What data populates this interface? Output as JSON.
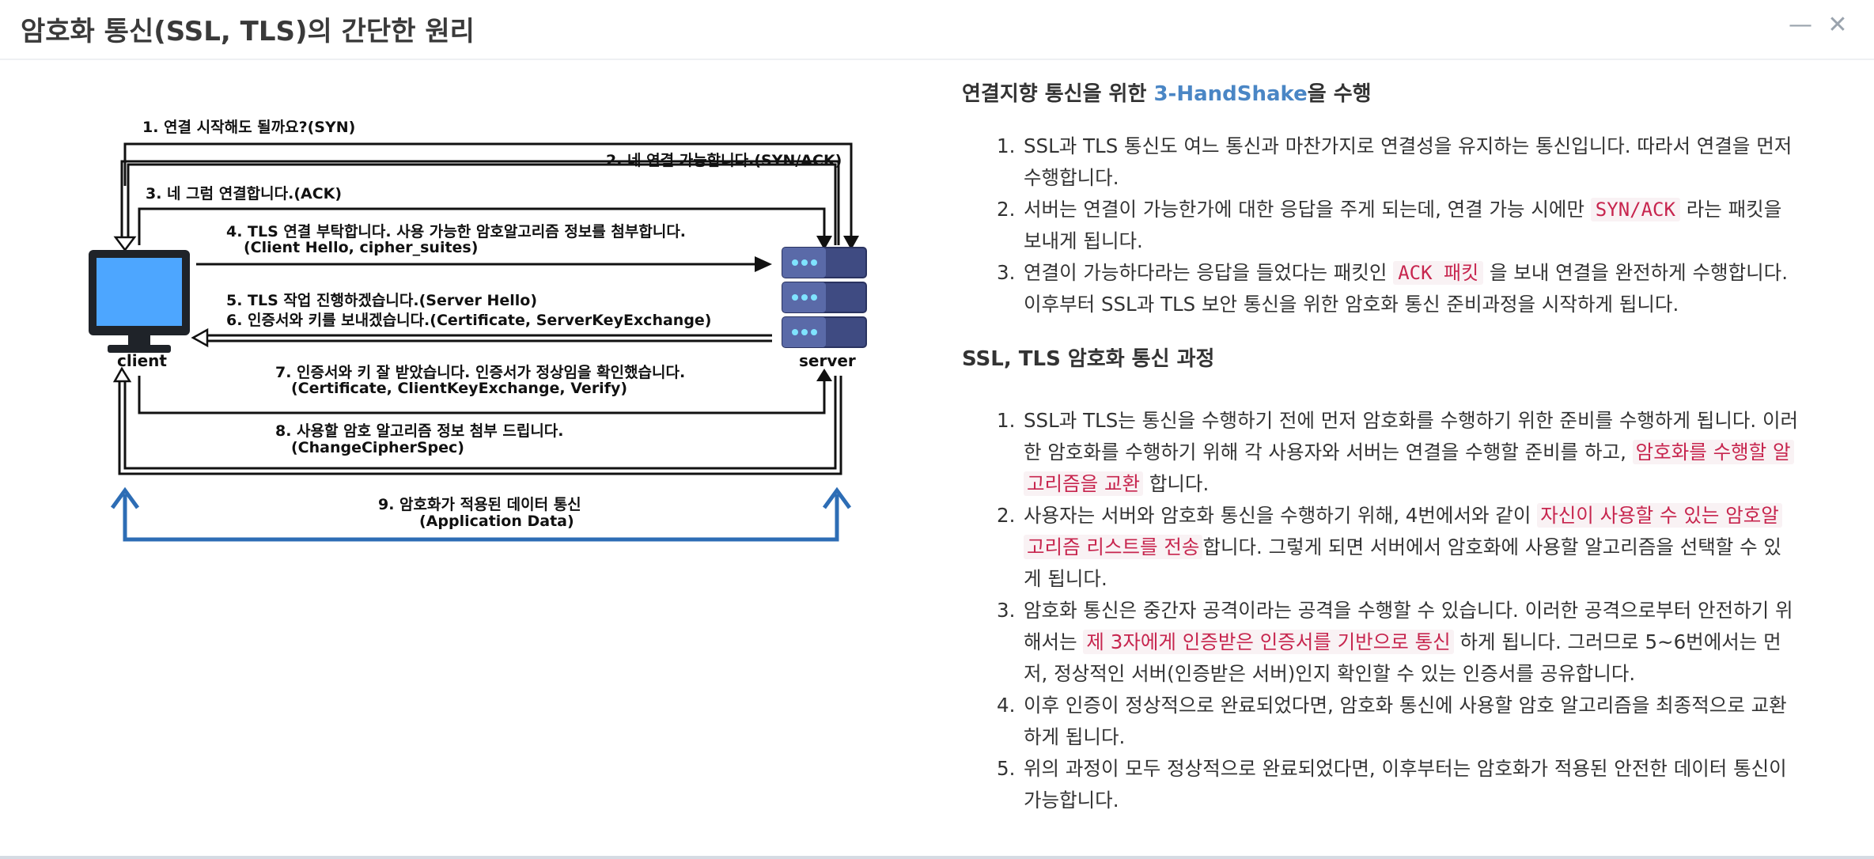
{
  "window": {
    "title": "암호화 통신(SSL, TLS)의 간단한 원리",
    "minimize_icon": "minimize-icon",
    "close_icon": "close-icon"
  },
  "diagram": {
    "client_label": "client",
    "server_label": "server",
    "steps": {
      "s1": "1. 연결 시작해도 될까요?(SYN)",
      "s2": "2. 네 연결 가능합니다.(SYN/ACK)",
      "s3": "3. 네 그럼 연결합니다.(ACK)",
      "s4a": "4. TLS 연결 부탁합니다. 사용 가능한 암호알고리즘 정보를 첨부합니다.",
      "s4b": "(Client Hello, cipher_suites)",
      "s5": "5. TLS 작업 진행하겠습니다.(Server Hello)",
      "s6": "6. 인증서와 키를 보내겠습니다.(Certificate, ServerKeyExchange)",
      "s7a": "7. 인증서와 키 잘 받았습니다. 인증서가 정상임을 확인했습니다.",
      "s7b": "(Certificate, ClientKeyExchange, Verify)",
      "s8a": "8. 사용할 암호 알고리즘 정보 첨부 드립니다.",
      "s8b": "(ChangeCipherSpec)",
      "s9a": "9. 암호화가 적용된 데이터 통신",
      "s9b": "(Application Data)"
    },
    "colors": {
      "monitor": "#4da6ff",
      "server": "#3f4b82",
      "data_arrow": "#2d6db5"
    }
  },
  "section1": {
    "heading_pre": "연결지향 통신을 위한 ",
    "heading_accent": "3-HandShake",
    "heading_post": "을 수행",
    "items": [
      {
        "num": "1.",
        "line1": "SSL과 TLS 통신도 여느 통신과 마찬가지로 연결성을 유지하는 통신입니다. 따라서 연결을 먼저",
        "line2": "수행합니다."
      },
      {
        "num": "2.",
        "pre": "서버는 연결이 가능한가에 대한 응답을 주게 되는데, 연결 가능 시에만 ",
        "code": "SYN/ACK",
        "post": " 라는 패킷을",
        "line2": "보내게 됩니다."
      },
      {
        "num": "3.",
        "pre": "연결이 가능하다라는 응답을 들었다는 패킷인 ",
        "code": "ACK 패킷",
        "post": " 을 보내 연결을 완전하게 수행합니다.",
        "line2": "이후부터 SSL과 TLS 보안 통신을 위한 암호화 통신 준비과정을 시작하게 됩니다."
      }
    ]
  },
  "section2": {
    "heading": "SSL, TLS 암호화 통신 과정",
    "items": [
      {
        "num": "1.",
        "line1": "SSL과 TLS는 통신을 수행하기 전에 먼저 암호화를 수행하기 위한 준비를 수행하게 됩니다. 이러",
        "line2_pre": "한 암호화를 수행하기 위해 각 사용자와 서버는 연결을 수행할 준비를 하고, ",
        "line2_hl": "암호화를 수행할 알",
        "line3_hl": "고리즘을 교환",
        "line3_post": " 합니다."
      },
      {
        "num": "2.",
        "line1_pre": "사용자는 서버와 암호화 통신을 수행하기 위해, 4번에서와 같이 ",
        "line1_hl": "자신이 사용할 수 있는 암호알",
        "line2_hl": "고리즘 리스트를 전송",
        "line2_post": "합니다. 그렇게 되면 서버에서 암호화에 사용할 알고리즘을 선택할 수 있",
        "line3": "게 됩니다."
      },
      {
        "num": "3.",
        "line1": "암호화 통신은 중간자 공격이라는 공격을 수행할 수 있습니다. 이러한 공격으로부터 안전하기 위",
        "line2_pre": "해서는 ",
        "line2_hl": "제 3자에게 인증받은 인증서를 기반으로 통신",
        "line2_post": " 하게 됩니다. 그러므로 5~6번에서는 먼",
        "line3": "저, 정상적인 서버(인증받은 서버)인지 확인할 수 있는 인증서를 공유합니다."
      },
      {
        "num": "4.",
        "line1": "이후 인증이 정상적으로 완료되었다면, 암호화 통신에 사용할 암호 알고리즘을 최종적으로 교환",
        "line2": "하게 됩니다."
      },
      {
        "num": "5.",
        "line1": "위의 과정이 모두 정상적으로 완료되었다면, 이후부터는 암호화가 적용된 안전한 데이터 통신이",
        "line2": "가능합니다."
      }
    ]
  }
}
